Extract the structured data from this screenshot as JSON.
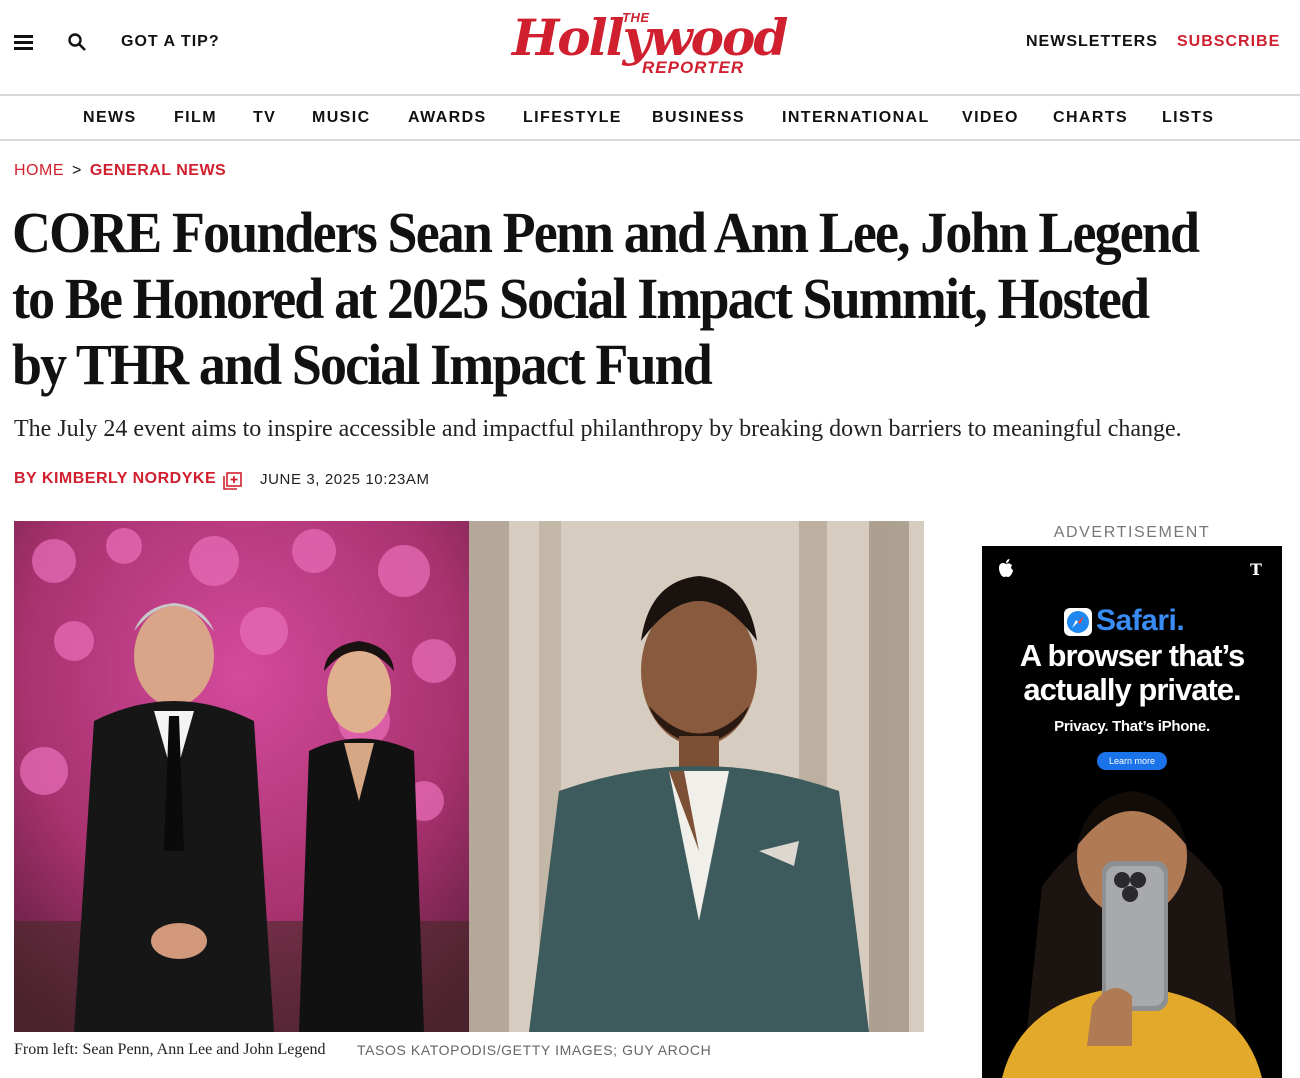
{
  "header": {
    "tip": "GOT A TIP?",
    "logo_the": "THE",
    "logo_main": "Hollywood",
    "logo_reporter": "REPORTER",
    "newsletters": "NEWSLETTERS",
    "subscribe": "SUBSCRIBE",
    "accent_color": "#d0202f"
  },
  "nav": {
    "items": [
      "NEWS",
      "FILM",
      "TV",
      "MUSIC",
      "AWARDS",
      "LIFESTYLE",
      "BUSINESS",
      "INTERNATIONAL",
      "VIDEO",
      "CHARTS",
      "LISTS"
    ]
  },
  "breadcrumb": {
    "home": "HOME",
    "separator": ">",
    "current": "GENERAL NEWS"
  },
  "article": {
    "headline": "CORE Founders Sean Penn and Ann Lee, John Legend to Be Honored at 2025 Social Impact Summit, Hosted by THR and Social Impact Fund",
    "dek": "The July 24 event aims to inspire accessible and impactful philanthropy by breaking down barriers to meaningful change.",
    "byline": "BY KIMBERLY NORDYKE",
    "date": "JUNE 3, 2025 10:23AM",
    "caption": "From left: Sean Penn, Ann Lee and John Legend",
    "credit": "TASOS KATOPODIS/GETTY IMAGES; GUY AROCH"
  },
  "ad": {
    "label": "ADVERTISEMENT",
    "brand": "Safari.",
    "headline_line1": "A browser that’s",
    "headline_line2": "actually private.",
    "subline": "Privacy. That’s iPhone.",
    "cta": "Learn more",
    "carrier_mark": "T",
    "brand_color": "#3a8cf5"
  }
}
